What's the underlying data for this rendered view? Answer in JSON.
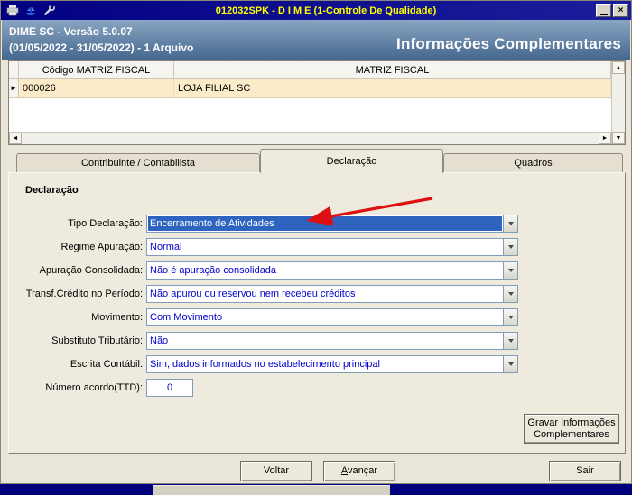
{
  "window": {
    "title": "012032SPK - D I M E (1-Controle De Qualidade)",
    "controls": {
      "close": "×"
    }
  },
  "header": {
    "app_version": "DIME SC - Versão 5.0.07",
    "period": "(01/05/2022 - 31/05/2022) - 1 Arquivo",
    "section_title": "Informações Complementares"
  },
  "grid": {
    "columns": [
      "Código MATRIZ FISCAL",
      "MATRIZ FISCAL"
    ],
    "rows": [
      {
        "codigo": "000026",
        "matriz": "LOJA FILIAL SC"
      }
    ]
  },
  "tabs": [
    {
      "label": "Contribuinte / Contabilista"
    },
    {
      "label": "Declaração"
    },
    {
      "label": "Quadros"
    }
  ],
  "form": {
    "group_title": "Declaração",
    "fields": [
      {
        "label": "Tipo Declaração:",
        "value": "Encerramento de Atividades"
      },
      {
        "label": "Regime Apuração:",
        "value": "Normal"
      },
      {
        "label": "Apuração Consolidada:",
        "value": "Não é apuração consolidada"
      },
      {
        "label": "Transf.Crédito no Período:",
        "value": "Não apurou ou reservou nem recebeu créditos"
      },
      {
        "label": "Movimento:",
        "value": "Com Movimento"
      },
      {
        "label": "Substituto Tributário:",
        "value": "Não"
      },
      {
        "label": "Escrita Contábil:",
        "value": "Sim, dados informados no estabelecimento principal"
      }
    ],
    "ttd": {
      "label": "Número acordo(TTD):",
      "value": "0"
    }
  },
  "buttons": {
    "gravar": "Gravar Informações Complementares",
    "voltar": "Voltar",
    "avancar": "Avançar",
    "sair": "Sair"
  },
  "icons": {
    "row_marker": "►",
    "up": "▲",
    "down": "▼",
    "left": "◄",
    "right": "►"
  },
  "colors": {
    "titlebar": "#020081",
    "title_text": "#ffff00",
    "selection": "#2e63c0",
    "dropdown_text": "#0000cc",
    "row_highlight": "#fcebc9",
    "annotation_arrow": "#dd1111"
  }
}
